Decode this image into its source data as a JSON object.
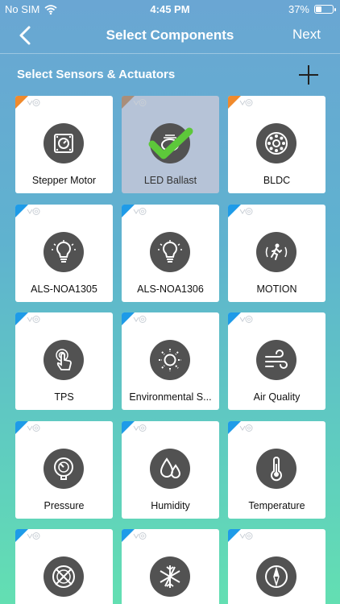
{
  "status_bar": {
    "carrier": "No SIM",
    "time": "4:45 PM",
    "battery": "37%",
    "battery_level": 0.37
  },
  "nav": {
    "title": "Select Components",
    "next_label": "Next"
  },
  "section": {
    "title": "Select Sensors & Actuators"
  },
  "components": [
    {
      "label": "Stepper Motor",
      "icon": "stepper-motor-icon",
      "badge": "orange",
      "selected": false
    },
    {
      "label": "LED Ballast",
      "icon": "led-ballast-icon",
      "badge": "brown",
      "selected": true
    },
    {
      "label": "BLDC",
      "icon": "bldc-icon",
      "badge": "orange",
      "selected": false
    },
    {
      "label": "ALS-NOA1305",
      "icon": "bulb-icon",
      "badge": "blue",
      "selected": false
    },
    {
      "label": "ALS-NOA1306",
      "icon": "bulb-icon",
      "badge": "blue",
      "selected": false
    },
    {
      "label": "MOTION",
      "icon": "motion-icon",
      "badge": "blue",
      "selected": false
    },
    {
      "label": "TPS",
      "icon": "touch-icon",
      "badge": "blue",
      "selected": false
    },
    {
      "label": "Environmental S...",
      "icon": "sun-icon",
      "badge": "blue",
      "selected": false
    },
    {
      "label": "Air Quality",
      "icon": "wind-icon",
      "badge": "blue",
      "selected": false
    },
    {
      "label": "Pressure",
      "icon": "pressure-gauge-icon",
      "badge": "blue",
      "selected": false
    },
    {
      "label": "Humidity",
      "icon": "humidity-icon",
      "badge": "blue",
      "selected": false
    },
    {
      "label": "Temperature",
      "icon": "thermometer-icon",
      "badge": "blue",
      "selected": false
    },
    {
      "label": "",
      "icon": "fan-off-icon",
      "badge": "blue",
      "selected": false
    },
    {
      "label": "",
      "icon": "snowflake-icon",
      "badge": "blue",
      "selected": false
    },
    {
      "label": "",
      "icon": "compass-icon",
      "badge": "blue",
      "selected": false
    }
  ],
  "colors": {
    "badge_blue": "#1e9be8",
    "badge_orange": "#f08a2c",
    "badge_brown": "#a98e7a",
    "check_green": "#5dc83a",
    "icon_bg": "#525252"
  }
}
